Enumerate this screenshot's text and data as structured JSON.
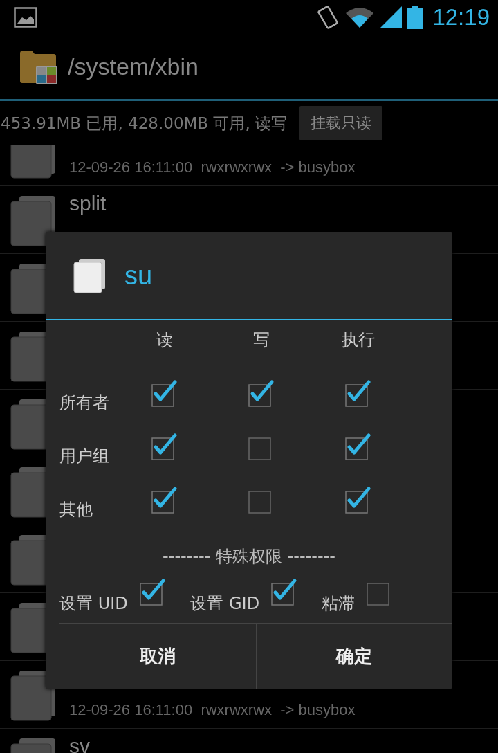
{
  "status_bar": {
    "time": "12:19"
  },
  "header": {
    "title": "/system/xbin"
  },
  "storage": {
    "text": "453.91MB 已用, 428.00MB 可用, 读写",
    "button": "挂载只读"
  },
  "files": [
    {
      "kind": "file",
      "meta": "12-09-26 16:11:00  rwxrwxrwx  -> busybox"
    },
    {
      "kind": "file",
      "name": "split"
    },
    {
      "kind": "file"
    },
    {
      "kind": "file"
    },
    {
      "kind": "file"
    },
    {
      "kind": "file"
    },
    {
      "kind": "file"
    },
    {
      "kind": "file"
    },
    {
      "kind": "file",
      "meta": "12-09-26 16:11:00  rwxrwxrwx  -> busybox"
    },
    {
      "kind": "file",
      "name": "sv"
    }
  ],
  "dialog": {
    "title": "su",
    "columns": [
      "读",
      "写",
      "执行"
    ],
    "rows": [
      {
        "label": "所有者",
        "checks": [
          true,
          true,
          true
        ]
      },
      {
        "label": "用户组",
        "checks": [
          true,
          false,
          true
        ]
      },
      {
        "label": "其他",
        "checks": [
          true,
          false,
          true
        ]
      }
    ],
    "special_heading": "-------- 特殊权限 --------",
    "special": [
      {
        "label": "设置 UID",
        "checked": true
      },
      {
        "label": "设置 GID",
        "checked": true
      },
      {
        "label": "粘滞",
        "checked": false
      }
    ],
    "buttons": [
      "取消",
      "确定"
    ]
  }
}
